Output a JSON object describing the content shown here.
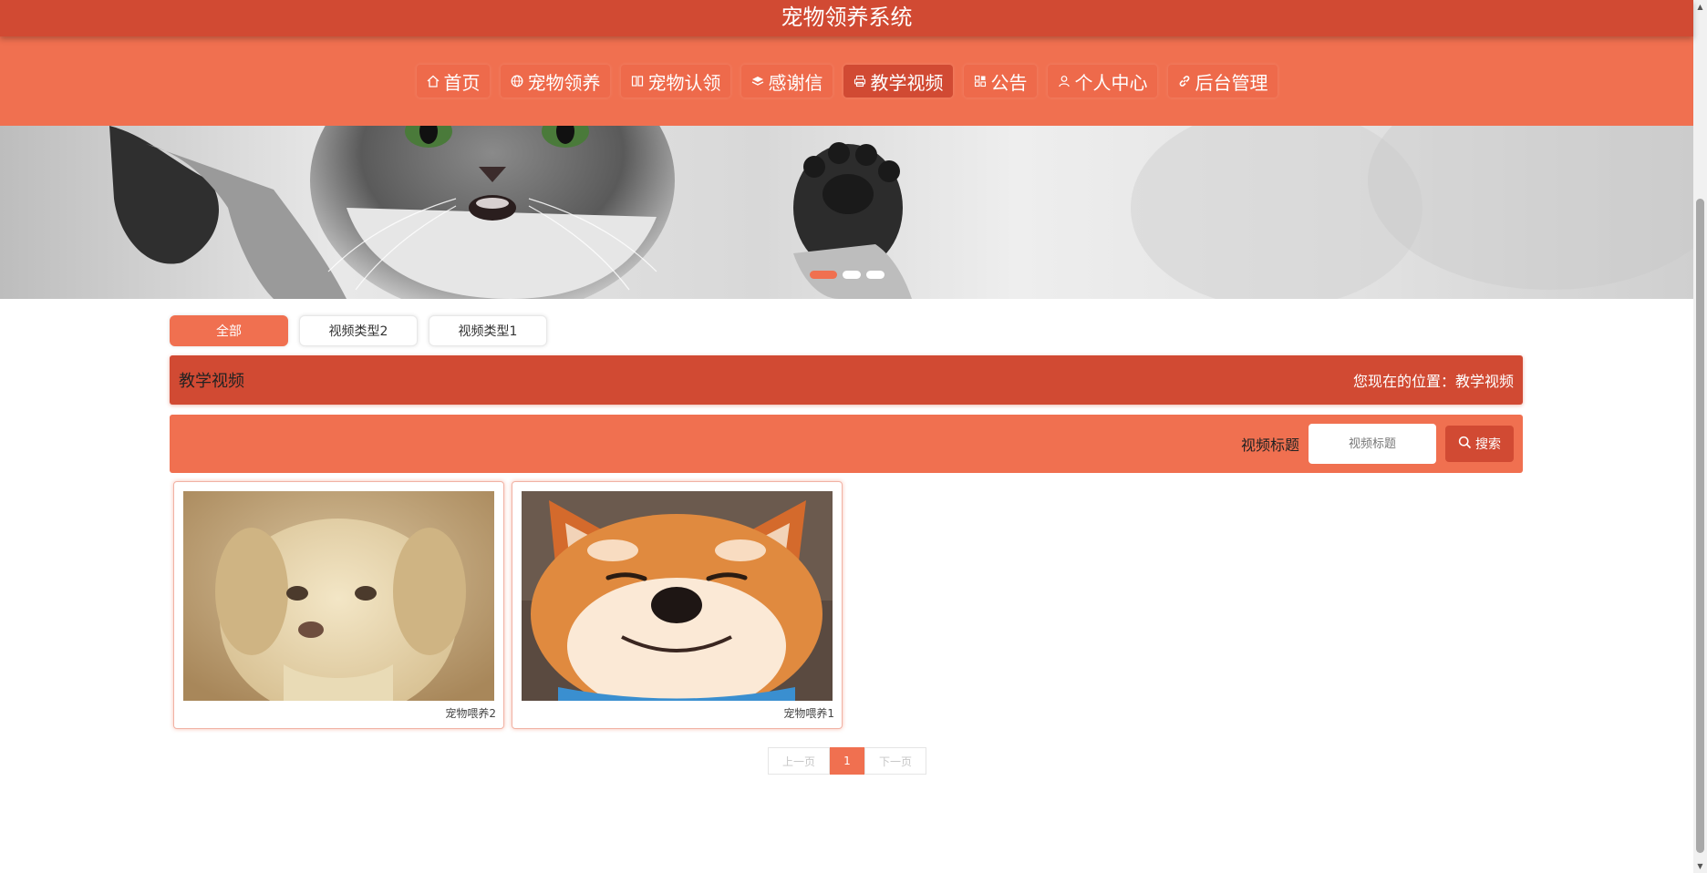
{
  "app": {
    "title": "宠物领养系统"
  },
  "nav": {
    "items": [
      {
        "label": "首页",
        "icon": "home-icon"
      },
      {
        "label": "宠物领养",
        "icon": "globe-icon"
      },
      {
        "label": "宠物认领",
        "icon": "columns-icon"
      },
      {
        "label": "感谢信",
        "icon": "layers-icon"
      },
      {
        "label": "教学视频",
        "icon": "print-icon",
        "active": true
      },
      {
        "label": "公告",
        "icon": "grid-icon"
      },
      {
        "label": "个人中心",
        "icon": "user-icon"
      },
      {
        "label": "后台管理",
        "icon": "link-icon"
      }
    ]
  },
  "banner": {
    "slide_count": 3,
    "active_index": 0
  },
  "tabs": [
    {
      "label": "全部",
      "active": true
    },
    {
      "label": "视频类型2",
      "active": false
    },
    {
      "label": "视频类型1",
      "active": false
    }
  ],
  "section": {
    "title": "教学视频",
    "location": "您现在的位置：教学视频"
  },
  "search": {
    "label": "视频标题",
    "placeholder": "视频标题",
    "value": "",
    "button_label": "搜索"
  },
  "cards": [
    {
      "caption": "宠物喂养2",
      "image": "puppy-image"
    },
    {
      "caption": "宠物喂养1",
      "image": "shiba-image"
    }
  ],
  "pagination": {
    "prev_label": "上一页",
    "current_page": "1",
    "next_label": "下一页"
  },
  "colors": {
    "primary_dark": "#d14a33",
    "primary": "#f07050"
  }
}
